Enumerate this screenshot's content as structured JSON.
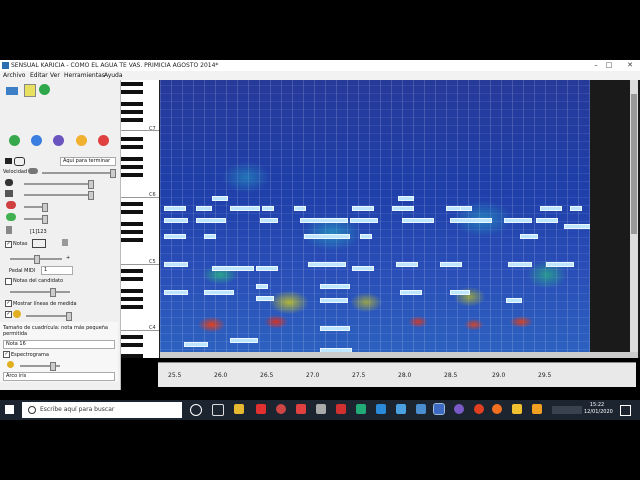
{
  "window": {
    "title": "SENSUAL KARICIA - COMO EL AGUA TE VAS. PRIMICIA AGOSTO 2014*"
  },
  "menu": [
    "Archivo",
    "Editar",
    "Ver",
    "Herramientas",
    "Ayuda"
  ],
  "left": {
    "aqui_para_terminar": "Aquí para terminar",
    "velocidad": "Velocidad",
    "counter": "[1]123",
    "notas": "Notas",
    "pedal_midi": "Pedal MIDI",
    "pedal_value": "1",
    "notas_candidato": "Notas del candidato",
    "mostrar_lineas": "Mostrar líneas de medida",
    "cuadricula": "Tamaño de cuadrícula: nota más pequeña permitida",
    "nota_value": "Nota 16",
    "espectrograma": "Espectrograma",
    "arco_value": "Arco iris"
  },
  "octaves": [
    "C7",
    "C6",
    "C5",
    "C4"
  ],
  "timeline": [
    "25.5",
    "26.0",
    "26.5",
    "27.0",
    "27.5",
    "28.0",
    "28.5",
    "29.0",
    "29.5"
  ],
  "search": {
    "placeholder": "Escribe aquí para buscar"
  },
  "clock": {
    "time": "15:22",
    "date": "12/01/2020"
  },
  "colors": {
    "roll_bg": "#2a4fb8",
    "note": "#bfe6ff",
    "taskbar": "#1c2430"
  }
}
